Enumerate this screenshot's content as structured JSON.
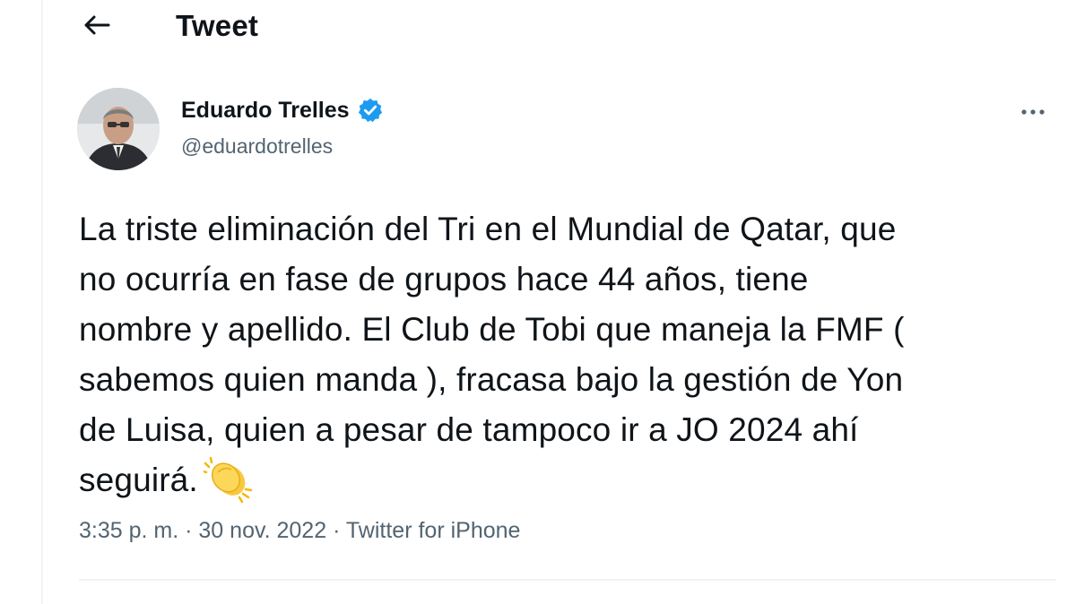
{
  "header": {
    "title": "Tweet"
  },
  "author": {
    "name": "Eduardo Trelles",
    "handle": "@eduardotrelles",
    "verified": true
  },
  "tweet": {
    "lines": [
      "La triste eliminación del Tri en el Mundial de Qatar, que",
      "no ocurría en fase de grupos hace 44 años, tiene",
      "nombre y apellido. El Club de Tobi que maneja la FMF (",
      "sabemos quien manda ), fracasa bajo la gestión de Yon",
      "de Luisa, quien a pesar de tampoco ir a JO 2024 ahí",
      "seguirá."
    ],
    "emoji": "clapping-hands-icon"
  },
  "meta": {
    "time": "3:35 p. m.",
    "separator": "·",
    "date": "30 nov. 2022",
    "source": "Twitter for iPhone"
  },
  "icons": {
    "back": "arrow-left-icon",
    "more": "more-horizontal-icon",
    "verified": "verified-badge-icon"
  },
  "colors": {
    "text": "#0f1419",
    "secondary": "#536471",
    "verified": "#1d9bf0",
    "divider": "#eff3f4"
  }
}
